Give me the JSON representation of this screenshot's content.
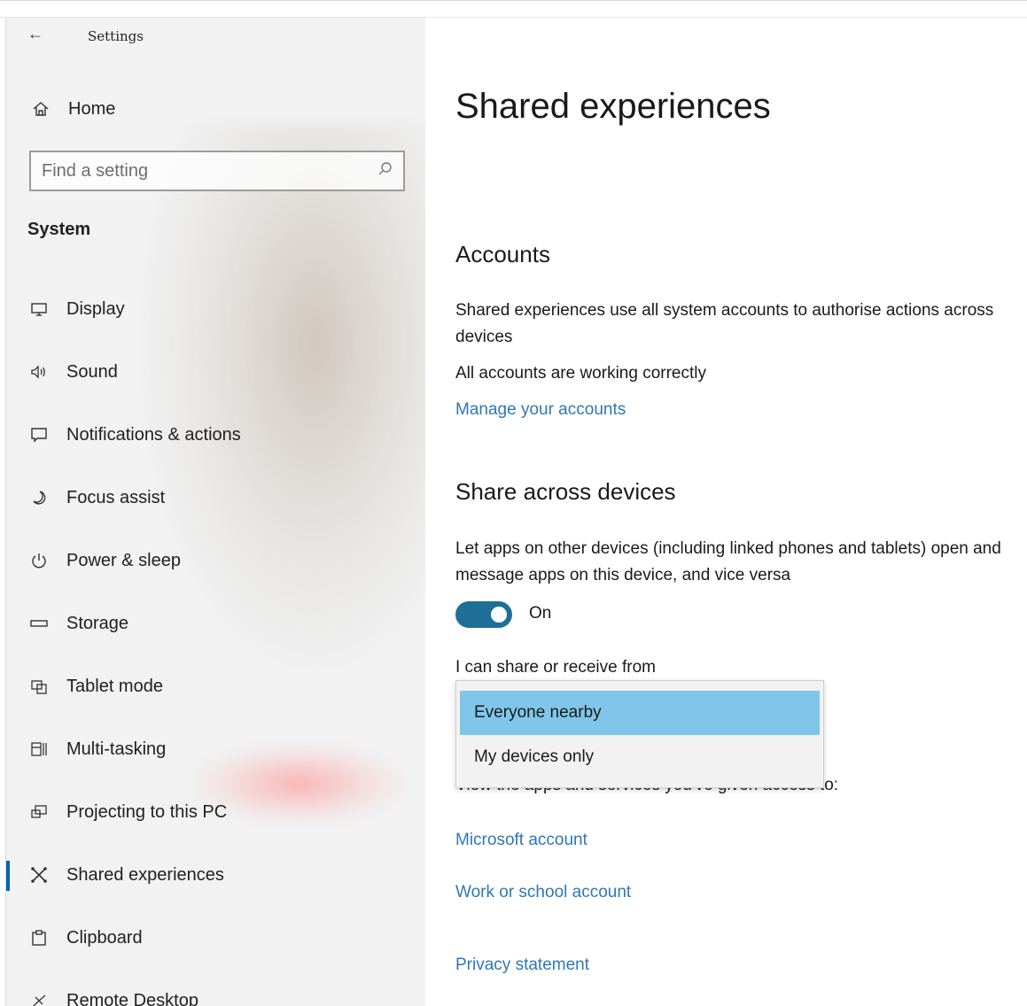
{
  "app": {
    "title": "Settings"
  },
  "sidebar": {
    "home_label": "Home",
    "search_placeholder": "Find a setting",
    "section": "System",
    "items": [
      {
        "label": "Display",
        "icon": "monitor-icon"
      },
      {
        "label": "Sound",
        "icon": "speaker-icon"
      },
      {
        "label": "Notifications & actions",
        "icon": "notification-icon"
      },
      {
        "label": "Focus assist",
        "icon": "moon-icon"
      },
      {
        "label": "Power & sleep",
        "icon": "power-icon"
      },
      {
        "label": "Storage",
        "icon": "storage-icon"
      },
      {
        "label": "Tablet mode",
        "icon": "tablet-icon"
      },
      {
        "label": "Multi-tasking",
        "icon": "multitasking-icon"
      },
      {
        "label": "Projecting to this PC",
        "icon": "projecting-icon"
      },
      {
        "label": "Shared experiences",
        "icon": "shared-icon",
        "selected": true
      },
      {
        "label": "Clipboard",
        "icon": "clipboard-icon"
      },
      {
        "label": "Remote Desktop",
        "icon": "remote-desktop-icon"
      }
    ]
  },
  "main": {
    "title": "Shared experiences",
    "accounts": {
      "heading": "Accounts",
      "description": "Shared experiences use all system accounts to authorise actions across devices",
      "status": "All accounts are working correctly",
      "manage_link": "Manage your accounts"
    },
    "share": {
      "heading": "Share across devices",
      "description": "Let apps on other devices (including linked phones and tablets) open and message apps on this device, and vice versa",
      "toggle_state": "On",
      "toggle_on": true,
      "share_from_label": "I can share or receive from",
      "dropdown_options": [
        "Everyone nearby",
        "My devices only"
      ],
      "dropdown_selected": "Everyone nearby",
      "access_text": "View the apps and services you've given access to:",
      "microsoft_link": "Microsoft account",
      "work_link": "Work or school account",
      "privacy_link": "Privacy statement"
    }
  },
  "colors": {
    "accent": "#0063b1",
    "link": "#2f77b5",
    "toggle": "#1e6f97",
    "selection": "#7fc6ea"
  }
}
